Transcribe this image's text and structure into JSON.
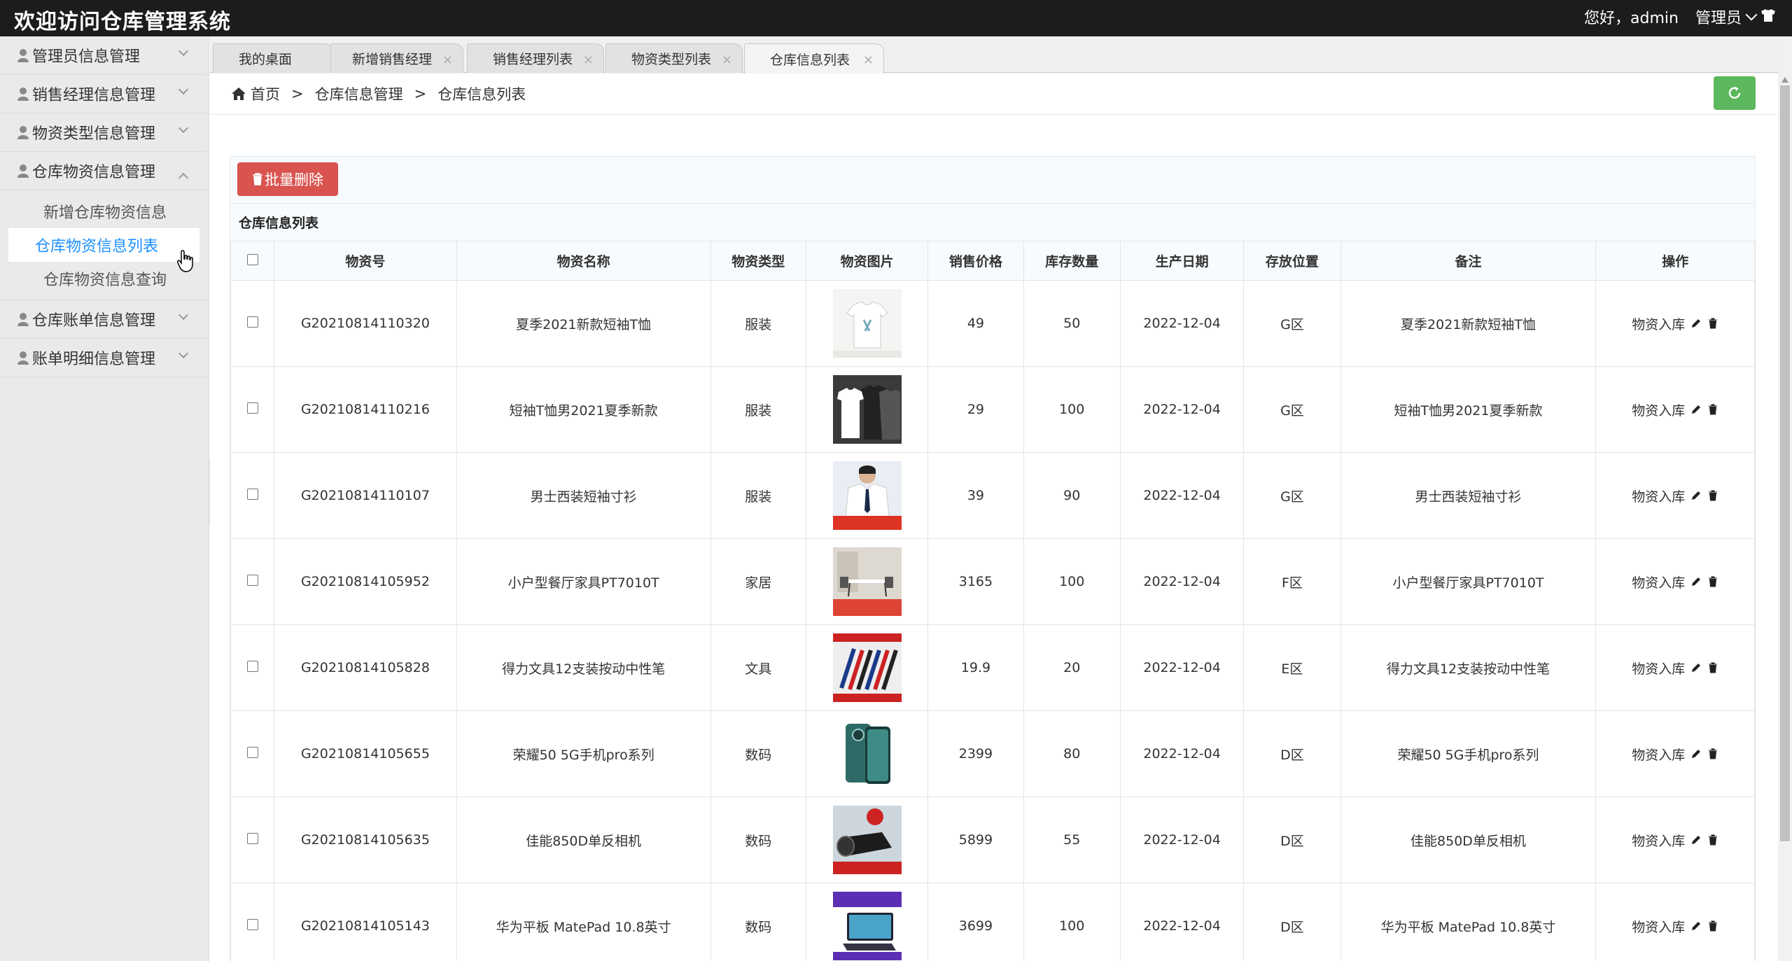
{
  "header": {
    "title": "欢迎访问仓库管理系统",
    "greeting": "您好，admin",
    "role": "管理员"
  },
  "sidebar": {
    "items": [
      {
        "label": "管理员信息管理"
      },
      {
        "label": "销售经理信息管理"
      },
      {
        "label": "物资类型信息管理"
      },
      {
        "label": "仓库物资信息管理"
      },
      {
        "label": "仓库账单信息管理"
      },
      {
        "label": "账单明细信息管理"
      }
    ],
    "subitems": [
      {
        "label": "新增仓库物资信息"
      },
      {
        "label": "仓库物资信息列表"
      },
      {
        "label": "仓库物资信息查询"
      }
    ]
  },
  "tabs": [
    {
      "label": "我的桌面"
    },
    {
      "label": "新增销售经理"
    },
    {
      "label": "销售经理列表"
    },
    {
      "label": "物资类型列表"
    },
    {
      "label": "仓库信息列表"
    }
  ],
  "breadcrumb": {
    "home": "首页",
    "sep": ">",
    "level1": "仓库信息管理",
    "level2": "仓库信息列表"
  },
  "toolbar": {
    "batch_delete": "批量删除"
  },
  "list": {
    "title": "仓库信息列表",
    "columns": [
      "物资号",
      "物资名称",
      "物资类型",
      "物资图片",
      "销售价格",
      "库存数量",
      "生产日期",
      "存放位置",
      "备注",
      "操作"
    ],
    "op_label": "物资入库",
    "rows": [
      {
        "id": "G20210814110320",
        "name": "夏季2021新款短袖T恤",
        "type": "服装",
        "price": "49",
        "qty": "50",
        "date": "2022-12-04",
        "loc": "G区",
        "note": "夏季2021新款短袖T恤"
      },
      {
        "id": "G20210814110216",
        "name": "短袖T恤男2021夏季新款",
        "type": "服装",
        "price": "29",
        "qty": "100",
        "date": "2022-12-04",
        "loc": "G区",
        "note": "短袖T恤男2021夏季新款"
      },
      {
        "id": "G20210814110107",
        "name": "男士西装短袖寸衫",
        "type": "服装",
        "price": "39",
        "qty": "90",
        "date": "2022-12-04",
        "loc": "G区",
        "note": "男士西装短袖寸衫"
      },
      {
        "id": "G20210814105952",
        "name": "小户型餐厅家具PT7010T",
        "type": "家居",
        "price": "3165",
        "qty": "100",
        "date": "2022-12-04",
        "loc": "F区",
        "note": "小户型餐厅家具PT7010T"
      },
      {
        "id": "G20210814105828",
        "name": "得力文具12支装按动中性笔",
        "type": "文具",
        "price": "19.9",
        "qty": "20",
        "date": "2022-12-04",
        "loc": "E区",
        "note": "得力文具12支装按动中性笔"
      },
      {
        "id": "G20210814105655",
        "name": "荣耀50 5G手机pro系列",
        "type": "数码",
        "price": "2399",
        "qty": "80",
        "date": "2022-12-04",
        "loc": "D区",
        "note": "荣耀50 5G手机pro系列"
      },
      {
        "id": "G20210814105635",
        "name": "佳能850D单反相机",
        "type": "数码",
        "price": "5899",
        "qty": "55",
        "date": "2022-12-04",
        "loc": "D区",
        "note": "佳能850D单反相机"
      },
      {
        "id": "G20210814105143",
        "name": "华为平板 MatePad 10.8英寸",
        "type": "数码",
        "price": "3699",
        "qty": "100",
        "date": "2022-12-04",
        "loc": "D区",
        "note": "华为平板 MatePad 10.8英寸"
      }
    ]
  },
  "colors": {
    "header_bg": "#1c1c1c",
    "active_link": "#1e90ff",
    "danger": "#d9534f",
    "success": "#5cb85c"
  }
}
